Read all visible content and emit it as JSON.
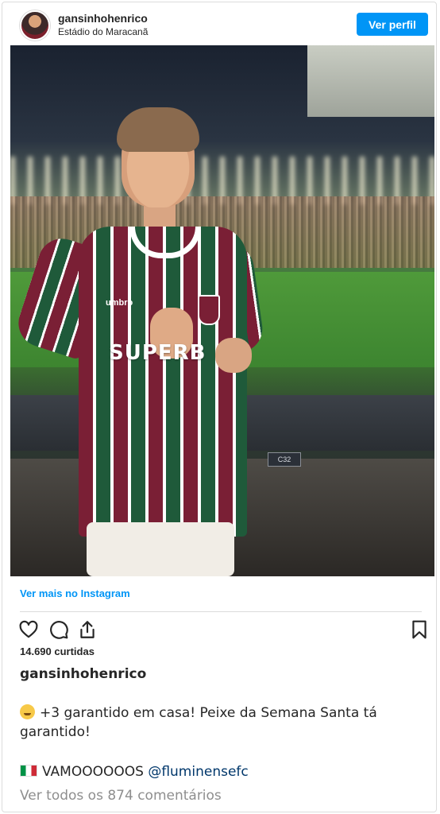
{
  "post": {
    "username": "gansinhohenrico",
    "location": "Estádio do Maracanã",
    "view_profile_label": "Ver perfil",
    "photo": {
      "sponsor_text": "SUPERB",
      "brand_text": "umbro",
      "stadium_sign": "C32"
    },
    "see_more_label": "Ver mais no Instagram",
    "actions": {
      "like_icon": "heart-icon",
      "comment_icon": "comment-icon",
      "share_icon": "share-icon",
      "save_icon": "bookmark-icon"
    },
    "likes_text": "14.690 curtidas",
    "caption_user": "gansinhohenrico",
    "caption_text": "+3 garantido em casa! Peixe da Semana Santa tá garantido!",
    "caption_line2_text": "VAMOOOOOOS",
    "caption_mention": "@fluminensefc",
    "view_comments_label": "Ver todos os 874 comentários"
  },
  "colors": {
    "primary_blue": "#0095f6",
    "mention_blue": "#00376b",
    "text": "#262626",
    "muted": "#8e8e8e"
  }
}
